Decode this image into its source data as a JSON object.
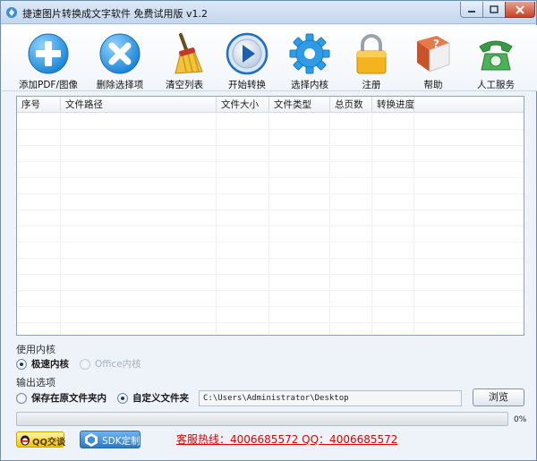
{
  "window": {
    "title": "捷速图片转换成文字软件 免费试用版 v1.2"
  },
  "toolbar": {
    "add_label": "添加PDF/图像",
    "delete_label": "删除选择项",
    "clear_label": "清空列表",
    "start_label": "开始转换",
    "engine_label": "选择内核",
    "register_label": "注册",
    "help_label": "帮助",
    "service_label": "人工服务",
    "help_icon_text": "?"
  },
  "table": {
    "columns": [
      "序号",
      "文件路径",
      "文件大小",
      "文件类型",
      "总页数",
      "转换进度"
    ],
    "rows": []
  },
  "engine": {
    "section_label": "使用内核",
    "options": [
      {
        "label": "极速内核",
        "selected": true,
        "enabled": true
      },
      {
        "label": "Office内核",
        "selected": false,
        "enabled": false
      }
    ]
  },
  "output": {
    "section_label": "输出选项",
    "options": [
      {
        "label": "保存在原文件夹内",
        "selected": false
      },
      {
        "label": "自定义文件夹",
        "selected": true
      }
    ],
    "path_value": "C:\\Users\\Administrator\\Desktop",
    "browse_label": "浏览"
  },
  "progress": {
    "value": 0,
    "text": "0%"
  },
  "footer": {
    "qq_label": "QQ交谈",
    "sdk_label": "SDK定制",
    "hotline": "客服热线：4006685572 QQ：4006685572"
  },
  "colors": {
    "accent_blue": "#2a9be8",
    "hotline_red": "#e00000",
    "progress_green": "#3ca32c"
  }
}
